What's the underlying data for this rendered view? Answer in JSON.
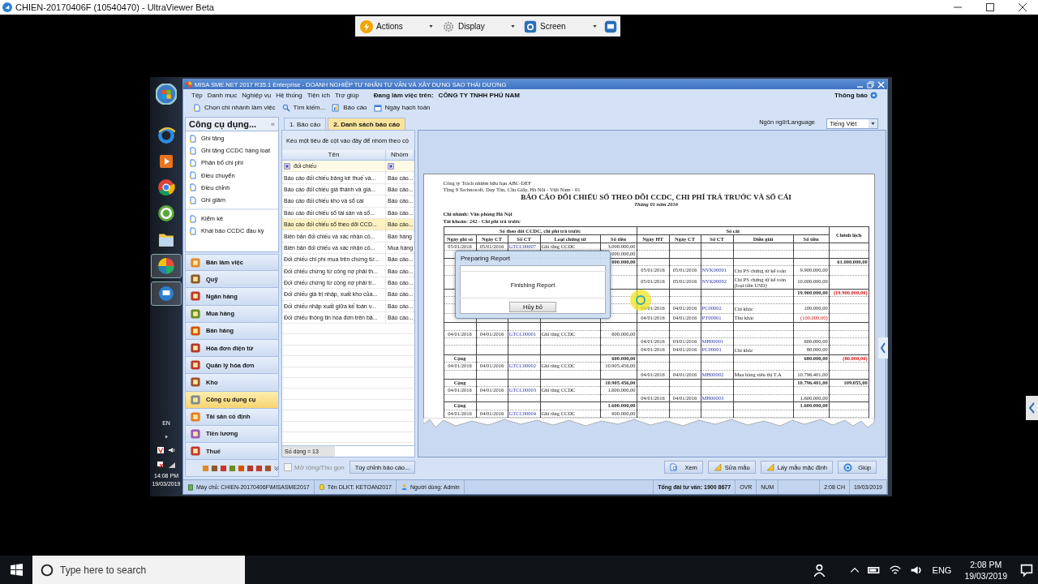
{
  "viewer": {
    "title": "CHIEN-20170406F (10540470) - UltraViewer Beta",
    "toolbar": [
      {
        "label": "Actions",
        "kind": "actions"
      },
      {
        "label": "Display",
        "kind": "display"
      },
      {
        "label": "Screen",
        "kind": "screen"
      }
    ]
  },
  "remote_taskbar": {
    "language": "EN",
    "time": "14:08 PM",
    "date": "19/03/2019"
  },
  "app": {
    "title": "MISA SME.NET 2017 R35.1 Enterprise - DOANH NGHIỆP TƯ NHÂN TƯ VẤN VÀ XÂY DỰNG SAO THÁI DƯƠNG",
    "menu": [
      "Tệp",
      "Danh mục",
      "Nghiệp vụ",
      "Hệ thống",
      "Tiện ích",
      "Trợ giúp"
    ],
    "working_on_label": "Đang làm việc trên:",
    "company": "CÔNG TY TNHH PHÚ NAM",
    "notifications": "Thông báo",
    "toolbar": [
      {
        "label": "Chọn chi nhánh làm việc",
        "kind": "branch"
      },
      {
        "label": "Tìm kiếm...",
        "kind": "search"
      },
      {
        "label": "Báo cáo",
        "kind": "report"
      },
      {
        "label": "Ngày hạch toán",
        "kind": "calendar"
      }
    ]
  },
  "sidebar": {
    "title": "Công cụ dụng...",
    "collapse": "«",
    "task_groups": [
      [
        "Ghi tăng",
        "Ghi tăng CCDC hàng loạt",
        "Phân bổ chi phí",
        "Điều chuyển",
        "Điều chỉnh",
        "Ghi giảm"
      ],
      [
        "Kiểm kê",
        "Khai báo CCDC đầu kỳ"
      ]
    ],
    "modules": [
      {
        "label": "Bàn làm việc",
        "selected": false
      },
      {
        "label": "Quỹ",
        "selected": false
      },
      {
        "label": "Ngân hàng",
        "selected": false
      },
      {
        "label": "Mua hàng",
        "selected": false
      },
      {
        "label": "Bán hàng",
        "selected": false
      },
      {
        "label": "Hóa đơn điện tử",
        "selected": false
      },
      {
        "label": "Quản lý hóa đơn",
        "selected": false
      },
      {
        "label": "Kho",
        "selected": false
      },
      {
        "label": "Công cụ dụng cụ",
        "selected": true
      },
      {
        "label": "Tài sản cố định",
        "selected": false
      },
      {
        "label": "Tiền lương",
        "selected": false
      },
      {
        "label": "Thuế",
        "selected": false
      }
    ]
  },
  "tabs": [
    {
      "label": "1. Báo cáo",
      "selected": false
    },
    {
      "label": "2. Danh sách báo cáo",
      "selected": true
    }
  ],
  "report_list": {
    "group_hint": "Kéo một tiêu đề cột vào đây để nhóm theo cộ",
    "columns": [
      "Tên",
      "Nhóm"
    ],
    "filter": "đối chiếu",
    "rows": [
      {
        "name": "Báo cáo đối chiếu bảng kê thuế và...",
        "group": "Báo cáo...",
        "selected": false
      },
      {
        "name": "Báo cáo đối chiếu giá thành và giá...",
        "group": "Báo cáo...",
        "selected": false
      },
      {
        "name": "Báo cáo đối chiếu kho và sổ cái",
        "group": "Báo cáo...",
        "selected": false
      },
      {
        "name": "Báo cáo đối chiếu sổ tài sản và sổ...",
        "group": "Báo cáo...",
        "selected": false
      },
      {
        "name": "Báo cáo đối chiếu sổ theo dõi CCD...",
        "group": "Báo cáo...",
        "selected": true
      },
      {
        "name": "Biên bản đối chiếu và xác nhận cô...",
        "group": "Bán hàng",
        "selected": false
      },
      {
        "name": "Biên bản đối chiếu và xác nhận cô...",
        "group": "Mua hàng",
        "selected": false
      },
      {
        "name": "Đối chiếu chi phí mua trên chứng từ...",
        "group": "Báo cáo...",
        "selected": false
      },
      {
        "name": "Đối chiếu chứng từ công nợ phải th...",
        "group": "Báo cáo...",
        "selected": false
      },
      {
        "name": "Đối chiếu chứng từ công nợ phải tr...",
        "group": "Báo cáo...",
        "selected": false
      },
      {
        "name": "Đối chiếu giá trị nhập, xuất kho của...",
        "group": "Báo cáo...",
        "selected": false
      },
      {
        "name": "Đối chiếu nhập xuất giữa kế toán v...",
        "group": "Báo cáo...",
        "selected": false
      },
      {
        "name": "Đối chiếu thông tin hóa đơn trên bả...",
        "group": "Báo cáo...",
        "selected": false
      }
    ],
    "row_count": "Số dòng = 13",
    "expand": {
      "label": "Mở rộng/Thu gọn",
      "checked": false,
      "disabled": true
    },
    "customize": "Tùy chỉnh báo cáo..."
  },
  "preview": {
    "language_label": "Ngôn ngữ/Language",
    "language": "Tiếng Việt",
    "report": {
      "company": "Công ty Trách nhiệm hữu hạn ABC-DEF",
      "address": "Tầng 9 Technosoft, Duy Tân, Cầu Giấy, Hà Nội - Việt Nam - 01",
      "title": "BÁO CÁO ĐỐI CHIẾU SỔ THEO DÕI CCDC, CHI PHÍ TRẢ TRƯỚC VÀ SỔ CÁI",
      "period": "Tháng 01 năm 2016",
      "branch": "Chi nhánh: Văn phòng Hà Nội",
      "account": "Tài khoản: 242 - Chi phí trả trước",
      "group_headers": [
        "Sổ theo dõi CCDC, chi phí trả trước",
        "Sổ cái",
        "Chênh lệch"
      ],
      "columns": [
        "Ngày ghi sổ",
        "Ngày CT",
        "Số CT",
        "Loại chứng từ",
        "Số tiền",
        "Ngày HT",
        "Ngày CT",
        "Số CT",
        "Diễn giải",
        "Số tiền"
      ],
      "rows": [
        {
          "kind": "detail",
          "cells": [
            "05/01/2016",
            "05/01/2016",
            "GTCC00007",
            "Ghi tăng CCDC",
            "3.000.000,00",
            null,
            null,
            null,
            null,
            null,
            null
          ]
        },
        {
          "kind": "detail",
          "cells": [
            null,
            null,
            null,
            null,
            "000.000,00",
            null,
            null,
            null,
            null,
            null,
            null
          ]
        },
        {
          "kind": "total",
          "cells": [
            null,
            null,
            null,
            null,
            "000.000,00",
            null,
            null,
            null,
            null,
            null,
            "61.000.000,00"
          ]
        },
        {
          "kind": "detail",
          "cells": [
            null,
            null,
            null,
            null,
            null,
            "05/01/2016",
            "05/01/2016",
            "NVK00001",
            "Chi PS chứng từ kế toán",
            "9.900.000,00",
            null
          ]
        },
        {
          "kind": "detail",
          "cells": [
            null,
            null,
            null,
            null,
            null,
            "05/01/2016",
            "05/01/2016",
            "NVK00002",
            "Chi PS chứng từ kế toán (loại tiền USD)",
            "10.000.000,00",
            null
          ]
        },
        {
          "kind": "total",
          "cells": [
            null,
            null,
            null,
            null,
            null,
            null,
            null,
            null,
            null,
            "19.900.000,00",
            {
              "text": "(19.900.000,00)",
              "red": true
            }
          ]
        },
        {
          "kind": "detail",
          "cells": [
            null,
            null,
            null,
            null,
            null,
            null,
            null,
            null,
            null,
            null,
            null
          ]
        },
        {
          "kind": "detail",
          "cells": [
            null,
            null,
            null,
            null,
            null,
            "04/01/2016",
            "04/01/2016",
            "PC00002",
            "Chi khác",
            "100.000,00",
            null
          ]
        },
        {
          "kind": "detail",
          "cells": [
            null,
            null,
            null,
            null,
            null,
            "04/01/2016",
            "04/01/2016",
            "PT00001",
            "Thu khác",
            {
              "text": "(100.000,00)",
              "red": true
            },
            null
          ]
        },
        {
          "kind": "total",
          "cells": [
            null,
            null,
            null,
            null,
            null,
            null,
            null,
            null,
            null,
            null,
            null
          ]
        },
        {
          "kind": "detail",
          "cells": [
            "04/01/2016",
            "04/01/2016",
            "GTCC00001",
            "Ghi tăng CCDC",
            "600.000,00",
            null,
            null,
            null,
            null,
            null,
            null
          ]
        },
        {
          "kind": "detail",
          "cells": [
            null,
            null,
            null,
            null,
            null,
            "04/01/2016",
            "03/01/2016",
            "MH00001",
            null,
            "600.000,00",
            null
          ]
        },
        {
          "kind": "detail",
          "cells": [
            null,
            null,
            null,
            null,
            null,
            "04/01/2016",
            "04/01/2016",
            "PC00001",
            "Chi khác",
            "80.000,00",
            null
          ]
        },
        {
          "kind": "total",
          "cells": [
            "Cộng",
            null,
            null,
            null,
            "600.000,00",
            null,
            null,
            null,
            null,
            "680.000,00",
            {
              "text": "(80.000,00)",
              "red": true
            }
          ]
        },
        {
          "kind": "detail",
          "cells": [
            "04/01/2016",
            "04/01/2016",
            "GTCC00002",
            "Ghi tăng CCDC",
            "10.905.456,00",
            null,
            null,
            null,
            null,
            null,
            null
          ]
        },
        {
          "kind": "detail",
          "cells": [
            null,
            null,
            null,
            null,
            null,
            "04/01/2016",
            "04/01/2016",
            "MH00002",
            "Mua hàng siêu thị T.A",
            "10.796.401,00",
            null
          ]
        },
        {
          "kind": "total",
          "cells": [
            "Cộng",
            null,
            null,
            null,
            "10.905.456,00",
            null,
            null,
            null,
            null,
            "10.796.401,00",
            "109.055,00"
          ]
        },
        {
          "kind": "detail",
          "cells": [
            "04/01/2016",
            "04/01/2016",
            "GTCC00003",
            "Ghi tăng CCDC",
            "1.600.000,00",
            null,
            null,
            null,
            null,
            null,
            null
          ]
        },
        {
          "kind": "detail",
          "cells": [
            null,
            null,
            null,
            null,
            null,
            "04/01/2016",
            "04/01/2016",
            "MH00003",
            null,
            "1.600.000,00",
            null
          ]
        },
        {
          "kind": "total",
          "cells": [
            "Cộng",
            null,
            null,
            null,
            "1.600.000,00",
            null,
            null,
            null,
            null,
            "1.600.000,00",
            null
          ]
        },
        {
          "kind": "detail",
          "cells": [
            "04/01/2016",
            "04/01/2016",
            "GTCC00004",
            "Ghi tăng CCDC",
            "600.000,00",
            null,
            null,
            null,
            null,
            null,
            null
          ]
        }
      ]
    },
    "buttons": [
      {
        "label": "Xem",
        "kind": "view"
      },
      {
        "label": "Sửa mẫu",
        "kind": "edit"
      },
      {
        "label": "Lấy mẫu mặc định",
        "kind": "edit"
      },
      {
        "label": "Giúp",
        "kind": "help"
      }
    ]
  },
  "dialog": {
    "title": "Preparing Report",
    "message": "Finishing Report",
    "cancel": "Hủy bỏ"
  },
  "status_bar": [
    {
      "text": "Máy chủ: CHIEN-20170406F\\MISASME2017",
      "kind": "server"
    },
    {
      "text": "Tên DLKT: KETOAN2017",
      "kind": "database"
    },
    {
      "text": "Người dùng: Admin",
      "kind": "user"
    },
    {
      "text": "Tổng đài tư vấn: 1900 8677",
      "kind": "hotline"
    },
    {
      "text": "OVR",
      "kind": "plain"
    },
    {
      "text": "NUM",
      "kind": "plain"
    },
    {
      "text": "2:08 CH",
      "kind": "clock"
    },
    {
      "text": "19/03/2019",
      "kind": "plain"
    }
  ],
  "taskbar": {
    "search_placeholder": "Type here to search",
    "language": "ENG",
    "time": "2:08 PM",
    "date": "19/03/2019"
  }
}
